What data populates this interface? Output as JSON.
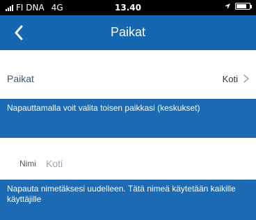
{
  "status_bar": {
    "carrier": "FI DNA",
    "network": "4G",
    "time": "13.40",
    "battery_level": 0.8
  },
  "header": {
    "title": "Paikat",
    "back_icon": "chevron-left-icon"
  },
  "places_row": {
    "label": "Paikat",
    "value": "Koti",
    "chevron_icon": "chevron-right-icon"
  },
  "banner_places": {
    "text": "Napauttamalla voit valita toisen paikkasi (keskukset)"
  },
  "name_field": {
    "label": "Nimi",
    "value": "Koti"
  },
  "banner_name": {
    "text": "Napauta nimetäksesi uudelleen. Tätä nimeä käytetään kaikille käyttäjille"
  },
  "colors": {
    "header_bg": "#1667b1",
    "banner_bg": "#1b6ab3",
    "status_bar_bg": "#000000"
  }
}
